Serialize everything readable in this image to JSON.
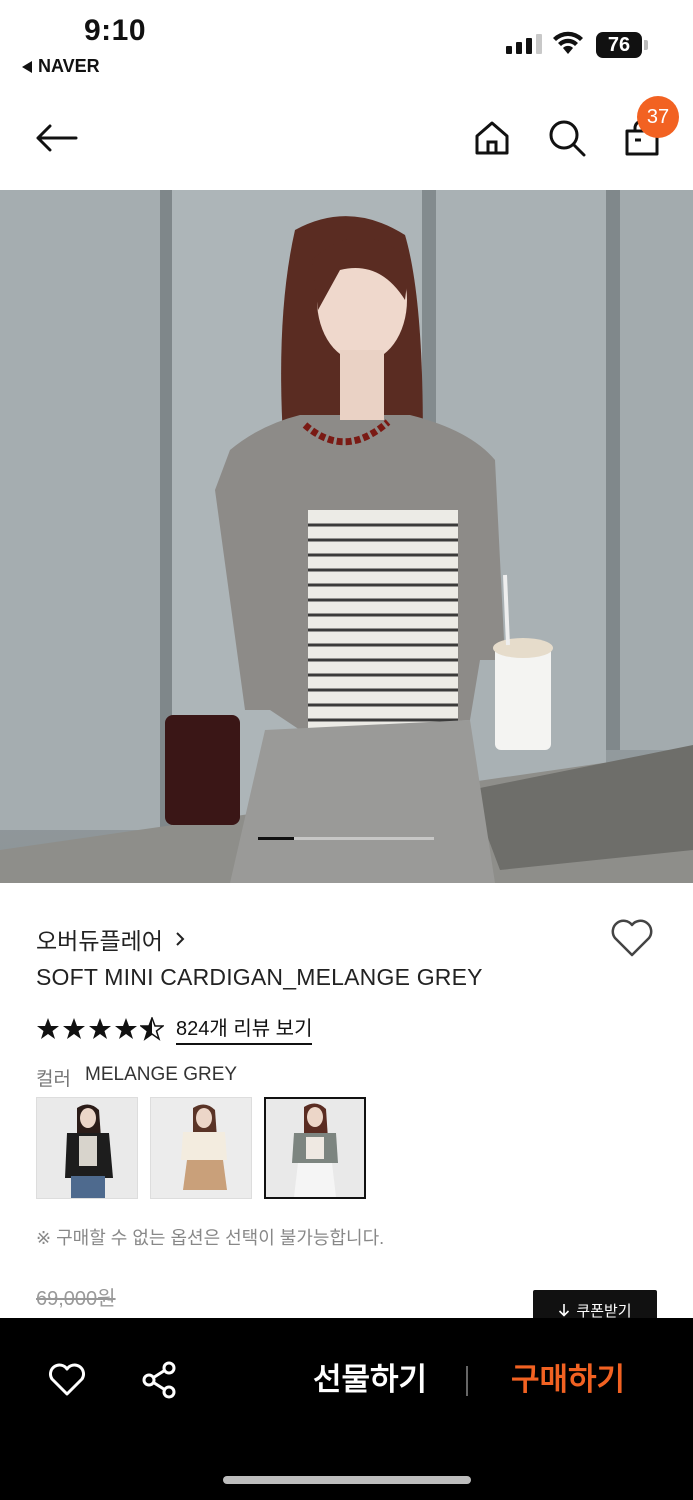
{
  "status_bar": {
    "time": "9:10",
    "back_app": "NAVER",
    "battery": "76"
  },
  "header": {
    "cart_count": "37"
  },
  "product": {
    "brand": "오버듀플레어",
    "name": "SOFT MINI CARDIGAN_MELANGE GREY",
    "rating": 4.5,
    "review_link": "824개 리뷰 보기",
    "color_label": "컬러",
    "color_value": "MELANGE GREY",
    "swatches": [
      {
        "name": "black-cardigan",
        "selected": false
      },
      {
        "name": "ivory-cardigan",
        "selected": false
      },
      {
        "name": "melange-grey-cardigan",
        "selected": true
      }
    ],
    "notice": "※ 구매할 수 없는 옵션은 선택이 불가능합니다.",
    "price_original": "69,000원",
    "coupon_label": "쿠폰받기"
  },
  "gallery": {
    "current_index": 1,
    "total": 5
  },
  "bottom_bar": {
    "gift_label": "선물하기",
    "buy_label": "구매하기"
  },
  "colors": {
    "accent": "#f26222",
    "bottom_bar_bg": "#000000"
  }
}
